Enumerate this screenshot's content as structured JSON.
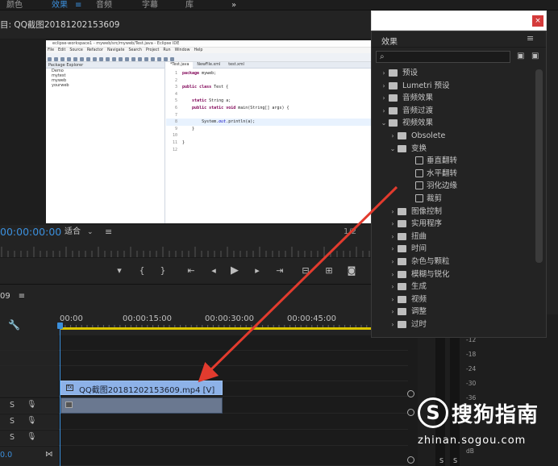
{
  "workspace_tabs": [
    {
      "label": "颜色",
      "active": false
    },
    {
      "label": "效果",
      "active": true
    },
    {
      "label": "音频",
      "active": false
    },
    {
      "label": "字幕",
      "active": false
    },
    {
      "label": "库",
      "active": false
    }
  ],
  "workspace_overflow": "»",
  "monitor": {
    "title": "目: QQ截图20181202153609",
    "timecode": "00:00:00:00",
    "fit_label": "适合",
    "ratio": "1/2"
  },
  "eclipse": {
    "window_title": "eclipse-workspace1 - myweb/src/myweb/Test.java - Eclipse IDE",
    "menu": [
      "File",
      "Edit",
      "Source",
      "Refactor",
      "Navigate",
      "Search",
      "Project",
      "Run",
      "Window",
      "Help"
    ],
    "explorer_title": "Package Explorer",
    "projects": [
      "Demo",
      "mytest",
      "myweb",
      "yourweb"
    ],
    "editor_tabs": [
      "*Test.java",
      "NewFile.xml",
      "test.xml"
    ],
    "code": [
      {
        "n": "1",
        "text": "package myweb;"
      },
      {
        "n": "2",
        "text": ""
      },
      {
        "n": "3",
        "text": "public class Test {"
      },
      {
        "n": "4",
        "text": ""
      },
      {
        "n": "5",
        "text": "    static String a;"
      },
      {
        "n": "6",
        "text": "    public static void main(String[] args) {"
      },
      {
        "n": "7",
        "text": ""
      },
      {
        "n": "8",
        "text": "        System.out.println(a);"
      },
      {
        "n": "9",
        "text": "    }"
      },
      {
        "n": "10",
        "text": ""
      },
      {
        "n": "11",
        "text": "}"
      },
      {
        "n": "12",
        "text": ""
      }
    ]
  },
  "timeline": {
    "sequence_label": "09",
    "ruler_labels": [
      "00:00",
      "00:00:15:00",
      "00:00:30:00",
      "00:00:45:00"
    ],
    "clip_video_label": "QQ截图20181202153609.mp4 [V]",
    "clip_fx_label": "fx",
    "track_labels": [
      "S",
      "S",
      "S"
    ],
    "bottom_timecode": "0.0"
  },
  "meters": {
    "labels": [
      "-12",
      "-18",
      "-24",
      "-30",
      "-36",
      "dB"
    ],
    "solo": [
      "S",
      "S"
    ]
  },
  "effects_panel": {
    "title": "效果",
    "close": "×",
    "items": [
      {
        "label": "预设",
        "type": "folder-star",
        "arrow": "›",
        "indent": 0
      },
      {
        "label": "Lumetri 预设",
        "type": "folder-star",
        "arrow": "›",
        "indent": 0
      },
      {
        "label": "音频效果",
        "type": "folder",
        "arrow": "›",
        "indent": 0
      },
      {
        "label": "音频过渡",
        "type": "folder",
        "arrow": "›",
        "indent": 0
      },
      {
        "label": "视频效果",
        "type": "folder",
        "arrow": "⌄",
        "indent": 0
      },
      {
        "label": "Obsolete",
        "type": "folder",
        "arrow": "›",
        "indent": 1
      },
      {
        "label": "变换",
        "type": "folder",
        "arrow": "⌄",
        "indent": 1
      },
      {
        "label": "垂直翻转",
        "type": "file",
        "arrow": "",
        "indent": 2
      },
      {
        "label": "水平翻转",
        "type": "file",
        "arrow": "",
        "indent": 2
      },
      {
        "label": "羽化边缘",
        "type": "file",
        "arrow": "",
        "indent": 2
      },
      {
        "label": "裁剪",
        "type": "file",
        "arrow": "",
        "indent": 2
      },
      {
        "label": "图像控制",
        "type": "folder",
        "arrow": "›",
        "indent": 1
      },
      {
        "label": "实用程序",
        "type": "folder",
        "arrow": "›",
        "indent": 1
      },
      {
        "label": "扭曲",
        "type": "folder",
        "arrow": "›",
        "indent": 1
      },
      {
        "label": "时间",
        "type": "folder",
        "arrow": "›",
        "indent": 1
      },
      {
        "label": "杂色与颗粒",
        "type": "folder",
        "arrow": "›",
        "indent": 1
      },
      {
        "label": "模糊与锐化",
        "type": "folder",
        "arrow": "›",
        "indent": 1
      },
      {
        "label": "生成",
        "type": "folder",
        "arrow": "›",
        "indent": 1
      },
      {
        "label": "视频",
        "type": "folder",
        "arrow": "›",
        "indent": 1
      },
      {
        "label": "调整",
        "type": "folder",
        "arrow": "›",
        "indent": 1
      },
      {
        "label": "过时",
        "type": "folder",
        "arrow": "›",
        "indent": 1
      }
    ]
  },
  "watermark": {
    "logo": "S",
    "text": "搜狗指南",
    "url": "zhinan.sogou.com"
  },
  "colors": {
    "accent": "#3b8fdc",
    "clip": "#8db2e8",
    "arrow": "#e23b2e"
  }
}
